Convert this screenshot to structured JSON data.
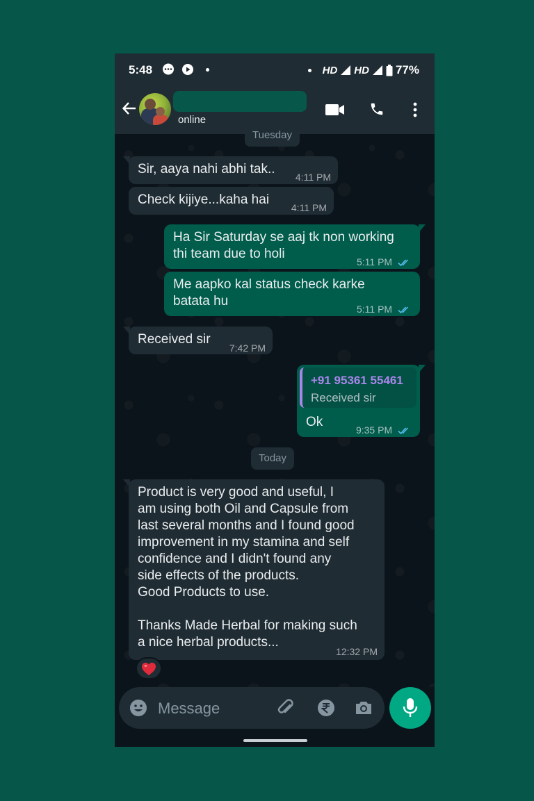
{
  "status_bar": {
    "time": "5:48",
    "network_1": "HD",
    "network_2": "HD",
    "battery": "77%"
  },
  "header": {
    "status": "online",
    "icons": [
      "back-arrow-icon",
      "avatar",
      "video-call-icon",
      "voice-call-icon",
      "more-options-icon"
    ]
  },
  "chat": {
    "date_partial": "Tuesday",
    "date_today": "Today",
    "messages": [
      {
        "dir": "in",
        "text": "Sir, aaya nahi abhi tak..",
        "time": "4:11 PM"
      },
      {
        "dir": "in",
        "text": "Check kijiye...kaha hai",
        "time": "4:11 PM"
      },
      {
        "dir": "out",
        "text": "Ha Sir Saturday se aaj tk non working\nthi team due to holi",
        "time": "5:11 PM",
        "status": "read"
      },
      {
        "dir": "out",
        "text": "Me aapko kal status check karke\nbatata hu",
        "time": "5:11 PM",
        "status": "read"
      },
      {
        "dir": "in",
        "text": "Received sir",
        "time": "7:42 PM"
      },
      {
        "dir": "out",
        "quote_name": "+91 95361 55461",
        "quote_text": "Received sir",
        "text": "Ok",
        "time": "9:35 PM",
        "status": "read"
      },
      {
        "dir": "in",
        "text": "Product is very good and useful, I\nam using both Oil and Capsule from\nlast several months and I found good\nimprovement in my stamina and self\nconfidence and I didn't found any\nside effects of the products.\nGood Products to use.\n\nThanks Made Herbal for making such\na nice herbal products...",
        "time": "12:32 PM",
        "reaction": "❤️"
      }
    ]
  },
  "input": {
    "placeholder": "Message"
  },
  "colors": {
    "background": "#06574a",
    "incoming_bubble": "#202c33",
    "outgoing_bubble": "#005c4b",
    "accent": "#00a884",
    "read_ticks": "#53bdeb"
  }
}
